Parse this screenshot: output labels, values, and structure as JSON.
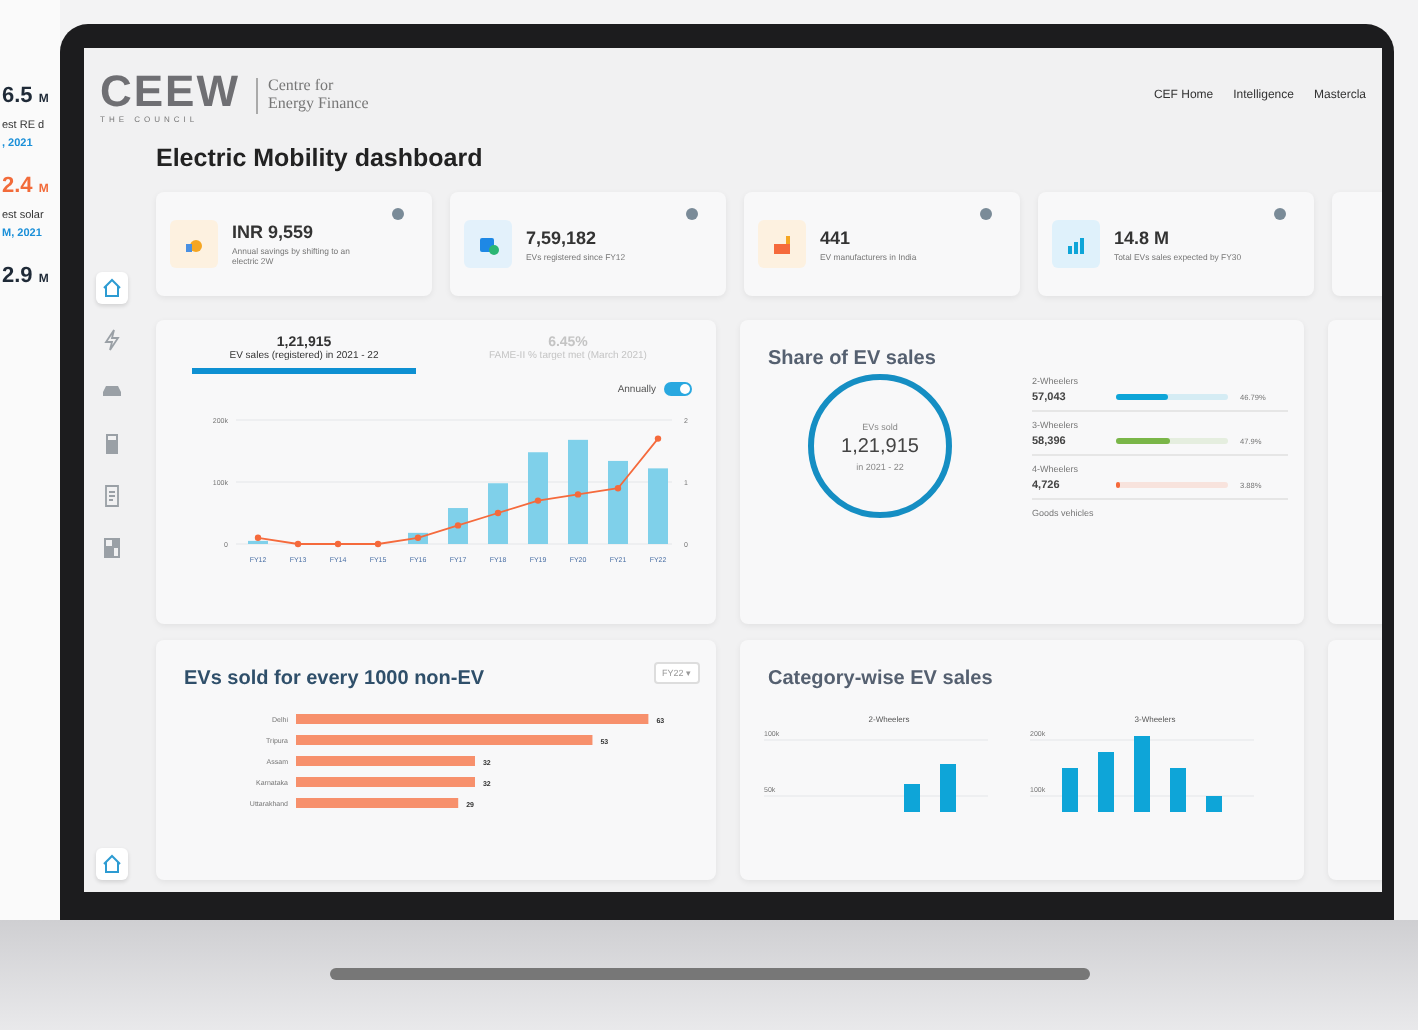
{
  "background_stats": [
    {
      "value": "6.5",
      "unit": "M",
      "label": "est RE d",
      "date": ", 2021",
      "color": "#1f2a37"
    },
    {
      "value": "2.4",
      "unit": "M",
      "label": "est solar",
      "date": "M, 2021",
      "color": "#f26b3a"
    },
    {
      "value": "2.9",
      "unit": "M",
      "color": "#1f2a37"
    }
  ],
  "header": {
    "logo": "CEEW",
    "logo_sub": "THE COUNCIL",
    "org": [
      "Centre for",
      "Energy Finance"
    ],
    "nav": [
      "CEF Home",
      "Intelligence",
      "Mastercla"
    ]
  },
  "sidebar": {
    "items": [
      {
        "kind": "home",
        "selected": true
      },
      {
        "kind": "bolt",
        "selected": false
      },
      {
        "kind": "car",
        "selected": false
      },
      {
        "kind": "calculator",
        "selected": false
      },
      {
        "kind": "document",
        "selected": false
      },
      {
        "kind": "panels",
        "selected": false
      }
    ],
    "bottom": {
      "kind": "home"
    }
  },
  "title": "Electric Mobility dashboard",
  "stats": [
    {
      "kind": "savings",
      "value": "INR 9,559",
      "label": "Annual savings by shifting to an electric 2W"
    },
    {
      "kind": "registered",
      "value": "7,59,182",
      "label": "EVs registered since FY12"
    },
    {
      "kind": "factory",
      "value": "441",
      "label": "EV manufacturers in India"
    },
    {
      "kind": "growth",
      "value": "14.8 M",
      "label": "Total EVs sales expected by FY30"
    }
  ],
  "sales_panel": {
    "tabs": [
      {
        "value": "1,21,915",
        "label": "EV sales (registered) in 2021 - 22",
        "selected": true
      },
      {
        "value": "6.45%",
        "label": "FAME-II % target met (March 2021)",
        "selected": false
      }
    ],
    "toggle": {
      "label": "Annually",
      "on": true
    },
    "chart_data": {
      "type": "bar",
      "categories": [
        "FY12",
        "FY13",
        "FY14",
        "FY15",
        "FY16",
        "FY17",
        "FY18",
        "FY19",
        "FY20",
        "FY21",
        "FY22"
      ],
      "series": [
        {
          "type": "bar",
          "color": "#7fd0ea",
          "values": [
            5000,
            null,
            null,
            null,
            18000,
            58000,
            98000,
            148000,
            168000,
            134000,
            122000
          ]
        },
        {
          "type": "line",
          "color": "#f56a3c",
          "axis": "y2",
          "marker": "circle",
          "values": [
            0.1,
            0.0,
            0.0,
            0.0,
            0.1,
            0.3,
            0.5,
            0.7,
            0.8,
            0.9,
            1.7
          ]
        }
      ],
      "ylim": [
        0,
        200000
      ],
      "y2lim": [
        0,
        2
      ],
      "yticks": [
        {
          "value": 0,
          "label": "0"
        },
        {
          "value": 100000,
          "label": "100k"
        },
        {
          "value": 200000,
          "label": "200k"
        }
      ],
      "y2ticks": [
        {
          "value": 0,
          "label": "0"
        },
        {
          "value": 1,
          "label": "1"
        },
        {
          "value": 2,
          "label": "2"
        }
      ]
    }
  },
  "share_panel": {
    "title": "Share of EV sales",
    "ring": {
      "caption": "EVs sold",
      "value": "1,21,915",
      "period": "in 2021 - 22"
    },
    "items": [
      {
        "kind": "bar",
        "label": "2-Wheelers",
        "count": "57,043",
        "level": 0.4679,
        "percent": "46.79%",
        "color": "#0ea5d8"
      },
      {
        "kind": "bar",
        "label": "3-Wheelers",
        "count": "58,396",
        "level": 0.479,
        "percent": "47.9%",
        "color": "#7ab648"
      },
      {
        "kind": "bar",
        "label": "4-Wheelers",
        "count": "4,726",
        "level": 0.0388,
        "percent": "3.88%",
        "color": "#f56a3c"
      },
      {
        "kind": "label",
        "label": "Goods vehicles"
      }
    ]
  },
  "ratio_panel": {
    "title": "EVs sold for every 1000 non-EV",
    "filter": "FY22 ▾",
    "chart_data": {
      "type": "bar",
      "orientation": "horizontal",
      "categories": [
        "Delhi",
        "Tripura",
        "Assam",
        "Karnataka",
        "Uttarakhand"
      ],
      "values": [
        63,
        53,
        32,
        32,
        29
      ],
      "value_labels": [
        "63",
        "53",
        "32",
        "32",
        "29"
      ],
      "color": "#f7906c"
    }
  },
  "category_panel": {
    "title": "Category-wise EV sales",
    "charts": [
      {
        "title": "2-Wheelers",
        "ticks": [
          "100k",
          "50k"
        ]
      },
      {
        "title": "3-Wheelers",
        "ticks": [
          "200k",
          "100k"
        ]
      }
    ]
  }
}
